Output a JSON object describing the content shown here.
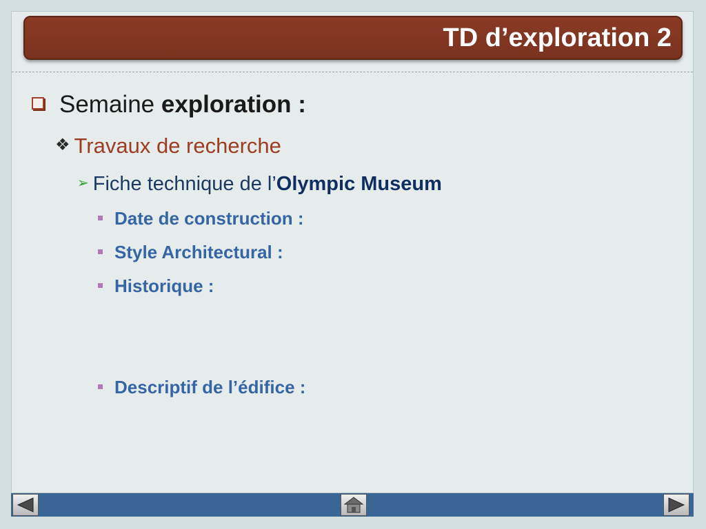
{
  "title": "TD d’exploration 2",
  "bullets": {
    "level1": {
      "text": "Semaine ",
      "bold": "exploration :"
    },
    "level2": {
      "text": "Travaux de recherche"
    },
    "level3": {
      "text": "Fiche technique de l’",
      "bold": "Olympic Museum"
    },
    "level4": [
      "Date de construction :",
      "Style Architectural :",
      "Historique :",
      "Descriptif de l’édifice :"
    ]
  },
  "icons": {
    "level1": "checkbox-square-bullet-icon",
    "level2": "four-diamond-bullet-icon",
    "level3": "arrowhead-bullet-icon",
    "level4": "small-square-bullet-icon",
    "nav_prev": "left-triangle-icon",
    "nav_home": "home-icon",
    "nav_next": "right-triangle-icon"
  },
  "colors": {
    "title_bar": "#7a3220",
    "level2_text": "#9b3c23",
    "level3_emphasis": "#0e2f5f",
    "level4_text": "#3566a3",
    "bottom_bar": "#3a6696"
  }
}
